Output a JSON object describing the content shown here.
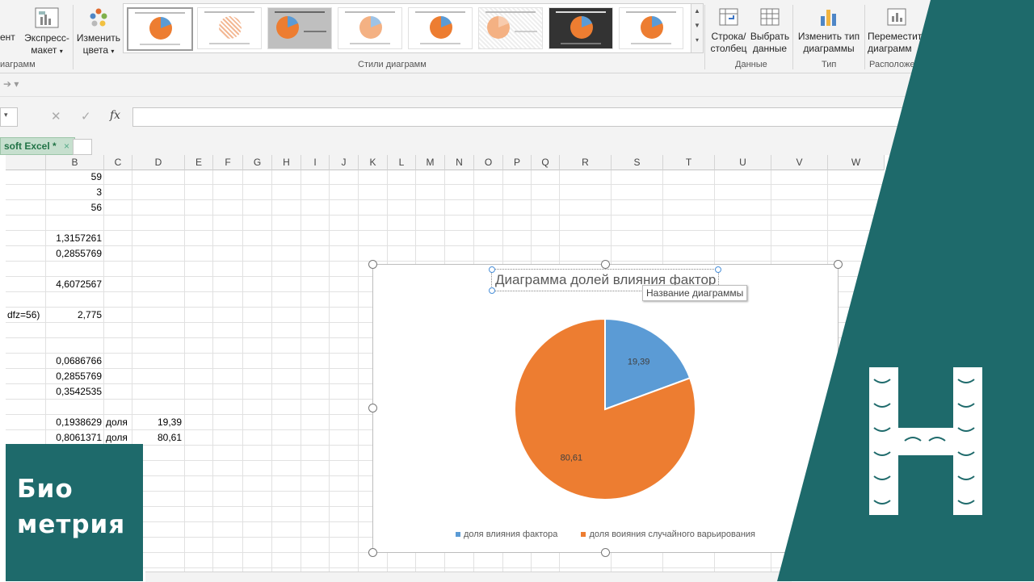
{
  "ribbon": {
    "partial_button_1": "ент",
    "quick_layout": "Экспресс-\nмакет",
    "group_layouts_partial": "иаграмм",
    "change_colors": "Изменить\nцвета",
    "styles_group": "Стили диаграмм",
    "switch_row_col": "Строка/\nстолбец",
    "select_data": "Выбрать\nданные",
    "data_group": "Данные",
    "change_type": "Изменить тип\nдиаграммы",
    "type_group": "Тип",
    "move_chart": "Переместить\nдиаграмм",
    "location_group": "Расположе"
  },
  "formula_bar": {
    "cancel": "✕",
    "enter": "✓",
    "fx": "fx",
    "value": ""
  },
  "workbook_tab": {
    "label": "soft Excel *",
    "close": "×"
  },
  "columns": [
    "B",
    "C",
    "D",
    "E",
    "F",
    "G",
    "H",
    "I",
    "J",
    "K",
    "L",
    "M",
    "N",
    "O",
    "P",
    "Q",
    "R",
    "S",
    "T",
    "U",
    "V",
    "W"
  ],
  "cells": {
    "b1": "59",
    "b2": "3",
    "b3": "56",
    "b5": "1,3157261",
    "b6": "0,2855769",
    "b8": "4,6072567",
    "a10": "dfz=56)",
    "b10": "2,775",
    "b13": "0,0686766",
    "b14": "0,2855769",
    "b15": "0,3542535",
    "b17": "0,1938629",
    "c17": "доля",
    "d17": "19,39",
    "b18": "0,8061371",
    "c18": "доля",
    "d18": "80,61"
  },
  "chart_data": {
    "type": "pie",
    "title": "Диаграмма долей влияния фактор",
    "tooltip": "Название диаграммы",
    "categories": [
      "доля влияния фактора",
      "доля воияния случайного варьирования"
    ],
    "values": [
      19.39,
      80.61
    ],
    "labels": [
      "19,39",
      "80,61"
    ],
    "colors": [
      "#5b9bd5",
      "#ed7d31"
    ],
    "legend": "bottom"
  },
  "overlay": {
    "bio_line1": "Био",
    "bio_line2": "метрия",
    "accent": "#1e6a6b"
  }
}
